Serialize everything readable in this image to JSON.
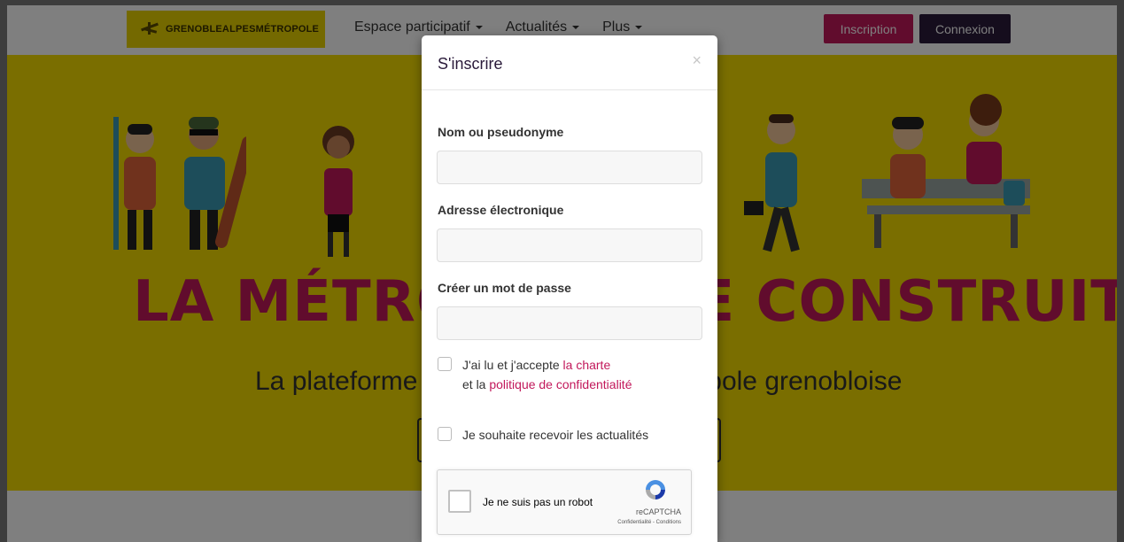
{
  "navbar": {
    "logo_text": "GRENOBLEALPESMÉTROPOLE",
    "menu": [
      {
        "label": "Espace participatif"
      },
      {
        "label": "Actualités"
      },
      {
        "label": "Plus"
      }
    ],
    "signup_label": "Inscription",
    "login_label": "Connexion"
  },
  "hero": {
    "title": "LA MÉTROPOLE SE CONSTRUIT",
    "subtitle": "La plateforme participative de la métropole grenobloise"
  },
  "modal": {
    "title": "S'inscrire",
    "close_icon": "×",
    "fields": {
      "name_label": "Nom ou pseudonyme",
      "name_value": "",
      "email_label": "Adresse électronique",
      "email_value": "",
      "password_label": "Créer un mot de passe",
      "password_value": ""
    },
    "charter": {
      "text_before": "J'ai lu et j'accepte ",
      "charter_link": "la charte",
      "text_and": "et la ",
      "privacy_link": "politique de confidentialité"
    },
    "newsletter_label": "Je souhaite recevoir les actualités",
    "recaptcha": {
      "label": "Je ne suis pas un robot",
      "brand": "reCAPTCHA",
      "terms": "Confidentialité - Conditions"
    }
  },
  "colors": {
    "brand_pink": "#c2185b",
    "brand_dark": "#2a1a3a",
    "hero_yellow": "#f4dd00"
  }
}
